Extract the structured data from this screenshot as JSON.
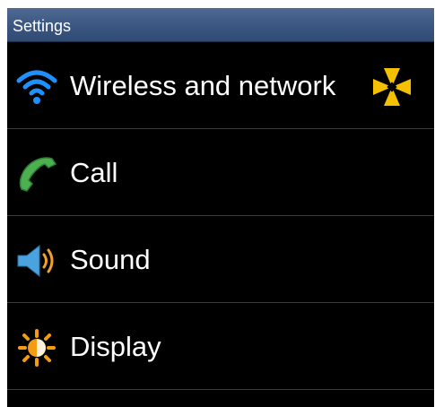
{
  "header": {
    "title": "Settings"
  },
  "settings_items": [
    {
      "label": "Wireless and network",
      "icon": "wifi-icon",
      "badge_icon": "sparkle-icon"
    },
    {
      "label": "Call",
      "icon": "phone-icon"
    },
    {
      "label": "Sound",
      "icon": "speaker-icon"
    },
    {
      "label": "Display",
      "icon": "brightness-icon"
    }
  ],
  "colors": {
    "title_bar": "#3b5680",
    "background": "#000000",
    "text": "#ffffff",
    "wifi": "#1e90ff",
    "phone": "#4caf50",
    "speaker": "#4aa3df",
    "sound_waves": "#f0a030",
    "display": "#f39c12",
    "sparkle": "#f5c000"
  }
}
